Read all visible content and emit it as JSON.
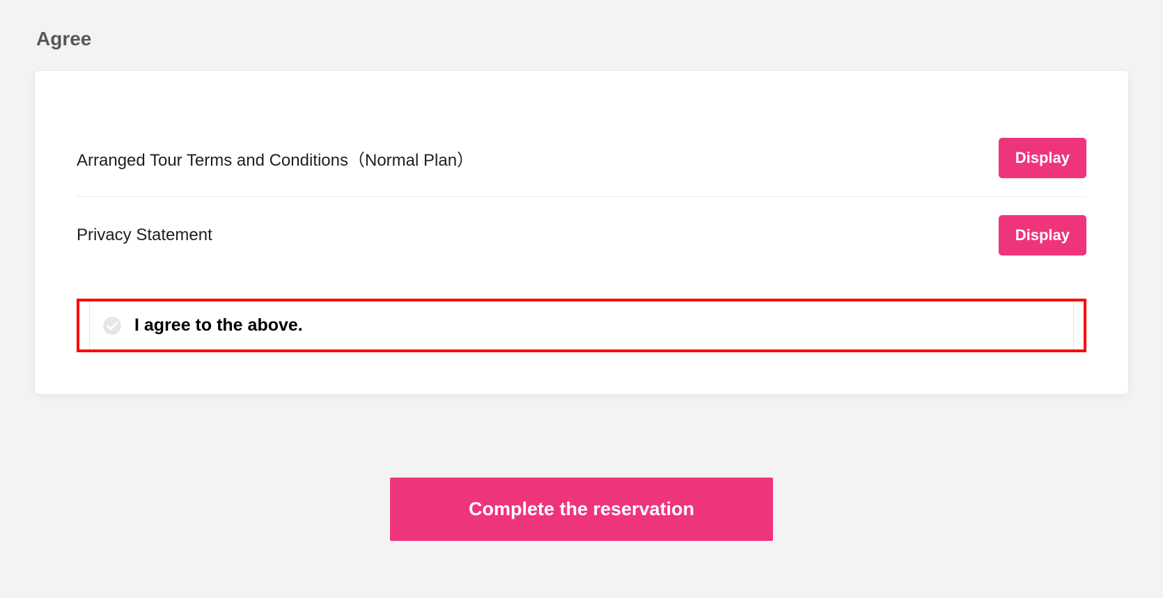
{
  "section_title": "Agree",
  "terms": [
    {
      "label": "Arranged Tour Terms and Conditions（Normal Plan）",
      "button": "Display"
    },
    {
      "label": "Privacy Statement",
      "button": "Display"
    }
  ],
  "agree_checkbox_label": "I agree to the above.",
  "cta_label": "Complete the reservation",
  "colors": {
    "accent": "#ee357c",
    "highlight_border": "#ff0000"
  }
}
